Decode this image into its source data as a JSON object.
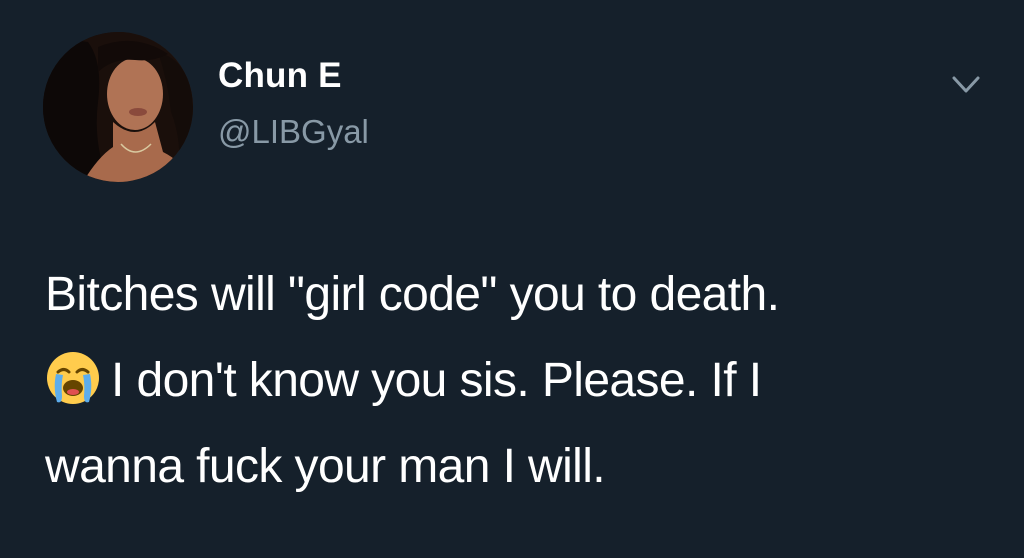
{
  "tweet": {
    "author_name": "Chun E",
    "author_handle": "@LIBGyal",
    "text_line_1": "Bitches will \"girl code\" you to death.",
    "text_line_2": "I don't know you sis. Please. If I",
    "text_line_3": "wanna fuck your man I will.",
    "emoji": "loudly-crying-face-emoji"
  },
  "icons": {
    "menu": "chevron-down-icon"
  },
  "colors": {
    "background": "#15202b",
    "primary_text": "#ffffff",
    "secondary_text": "#8899a6"
  }
}
